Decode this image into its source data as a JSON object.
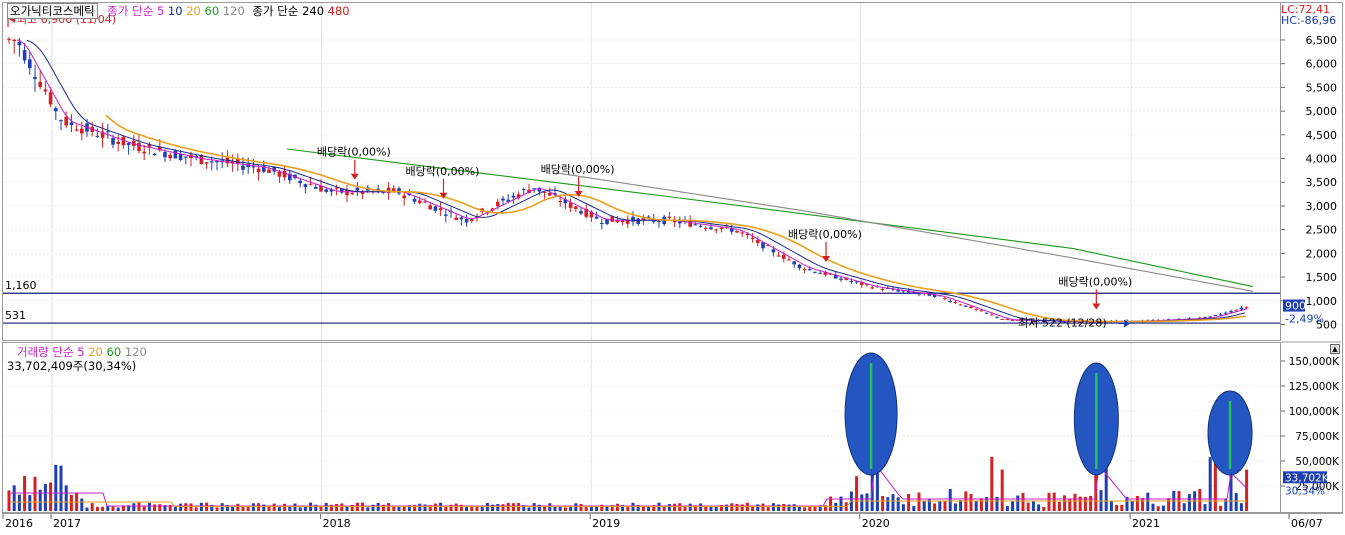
{
  "legend_price": {
    "stock_name": "오가닉티코스메틱",
    "ma_label": "종가 단순",
    "ma_periods": [
      "5",
      "10",
      "20",
      "60",
      "120"
    ],
    "ma_label2": "종가 단순",
    "ma_periods2": [
      "240",
      "480"
    ]
  },
  "legend_volume": {
    "title": "거래량",
    "ma_label": "단순",
    "ma_periods": [
      "5",
      "20",
      "60",
      "120"
    ],
    "current": "33,702,409주(30,34%)"
  },
  "indicators": {
    "lc": "LC:72,41",
    "hc": "HC:-86,96"
  },
  "annotations": {
    "high": "최고 6,900 (11/04)",
    "low": "최저 522 (12/28)",
    "level_high": "1,160",
    "level_low": "531",
    "dividend": "배당락(0,00%)",
    "price_now": "900",
    "price_change": "-2,49%",
    "volume_now": "33,702K",
    "volume_pct": "30,34%"
  },
  "right_axis_price": [
    "6,500",
    "6,000",
    "5,500",
    "5,000",
    "4,500",
    "4,000",
    "3,500",
    "3,000",
    "2,500",
    "2,000",
    "1,500",
    "1,000",
    "500"
  ],
  "right_axis_volume": [
    "150,000K",
    "125,000K",
    "100,000K",
    "75,000K",
    "50,000K",
    "25,000K"
  ],
  "x_axis": [
    "2016",
    "2017",
    "2018",
    "2019",
    "2020",
    "2021",
    "06/07"
  ],
  "colors": {
    "up": "#d42020",
    "down": "#1c3fb4",
    "ma5": "#c81ec8",
    "ma10": "#1a2a8a",
    "ma20": "#e8a020",
    "ma60": "#1a9a1a",
    "ma120": "#8a8a8a",
    "ellipse": "#2456c2",
    "highlight": "#21c25a"
  },
  "chart_data": {
    "type": "candlestick",
    "x_range": [
      "2016-11-01",
      "2021-06-07"
    ],
    "ylim": [
      0,
      7000
    ],
    "price_series": {
      "name": "",
      "x": [
        "2016-11",
        "2017-01",
        "2017-04",
        "2017-07",
        "2017-10",
        "2018-01",
        "2018-04",
        "2018-07",
        "2018-10",
        "2019-01",
        "2019-04",
        "2019-07",
        "2019-10",
        "2020-01",
        "2020-04",
        "2020-07",
        "2020-10",
        "2021-01",
        "2021-04",
        "2021-06"
      ],
      "values": [
        6500,
        4800,
        4300,
        4000,
        3800,
        3300,
        3300,
        2700,
        3400,
        2700,
        2700,
        2500,
        1700,
        1300,
        1100,
        600,
        560,
        570,
        640,
        900
      ]
    },
    "ma240": {
      "x": [
        "2017-11",
        "2019-04",
        "2020-10",
        "2021-06"
      ],
      "values": [
        4200,
        3200,
        2100,
        1300
      ]
    },
    "ma480": {
      "x": [
        "2018-11",
        "2019-10",
        "2020-10",
        "2021-06"
      ],
      "values": [
        3700,
        2900,
        1900,
        1200
      ]
    },
    "high": {
      "value": 6900,
      "date": "11/04"
    },
    "low": {
      "value": 522,
      "date": "12/28"
    },
    "levels": [
      1160,
      531
    ],
    "dividend_markers": [
      "2018-02",
      "2018-06",
      "2018-12",
      "2019-11",
      "2020-11"
    ],
    "volume": {
      "ylim": [
        0,
        160000
      ],
      "unit": "K",
      "highlight": [
        {
          "x": "2020-01",
          "value": 150000
        },
        {
          "x": "2020-11",
          "value": 140000
        },
        {
          "x": "2021-05",
          "value": 112000
        }
      ],
      "last": 33702
    }
  }
}
